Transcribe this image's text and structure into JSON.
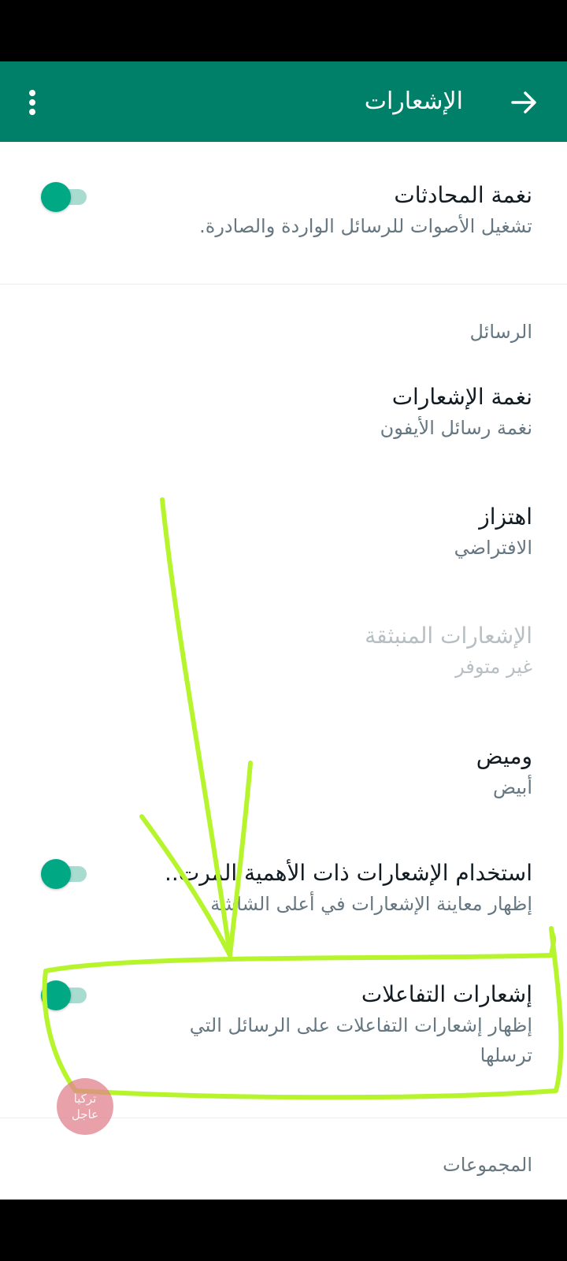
{
  "app_bar": {
    "title": "الإشعارات",
    "back_icon": "arrow-back-icon",
    "menu_icon": "more-vert-icon",
    "color": "#008069"
  },
  "conversation_tones": {
    "title": "نغمة المحادثات",
    "subtitle": "تشغيل الأصوات للرسائل الواردة والصادرة.",
    "toggle_on": true
  },
  "messages_section": {
    "label": "الرسائل",
    "notification_tone": {
      "title": "نغمة الإشعارات",
      "value": "نغمة رسائل الأيفون"
    },
    "vibrate": {
      "title": "اهتزاز",
      "value": "الافتراضي"
    },
    "popup": {
      "title": "الإشعارات المنبثقة",
      "value": "غير متوفر"
    },
    "light": {
      "title": "وميض",
      "value": "أبيض"
    },
    "high_priority": {
      "title": "استخدام الإشعارات ذات الأهمية المرت..",
      "subtitle": "إظهار معاينة الإشعارات في أعلى الشاشة",
      "toggle_on": true
    },
    "reactions": {
      "title": "إشعارات التفاعلات",
      "subtitle_line1": "إظهار إشعارات التفاعلات على الرسائل التي",
      "subtitle_line2": "ترسلها",
      "toggle_on": true
    }
  },
  "groups_section": {
    "label": "المجموعات"
  },
  "watermark": {
    "line1": "تركيا",
    "line2": "عاجل"
  },
  "colors": {
    "accent": "#00a884",
    "annotation": "#b6f52c"
  }
}
